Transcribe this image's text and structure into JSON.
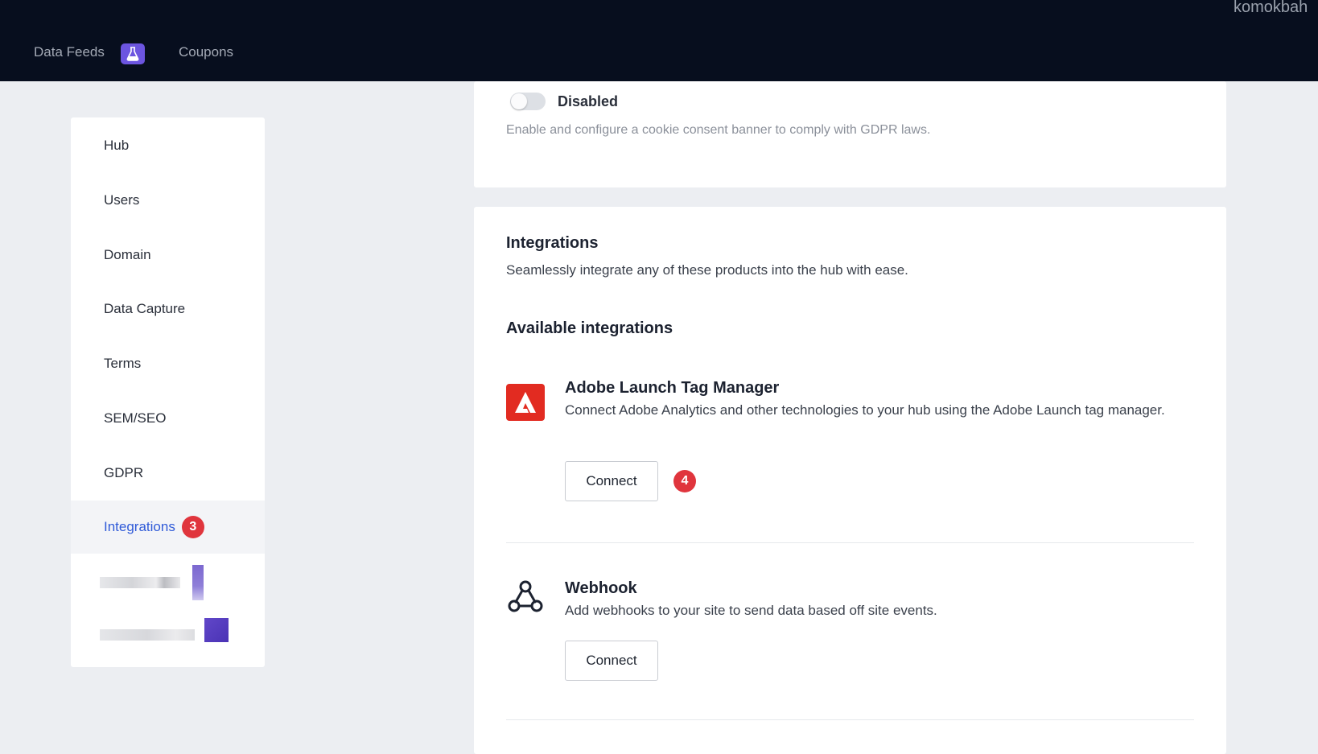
{
  "topbar": {
    "user": "komokbah",
    "nav": [
      {
        "label": "Data Feeds",
        "icon": "flask-icon"
      },
      {
        "label": "Coupons"
      }
    ]
  },
  "sidebar": {
    "items": [
      {
        "label": "Hub"
      },
      {
        "label": "Users"
      },
      {
        "label": "Domain"
      },
      {
        "label": "Data Capture"
      },
      {
        "label": "Terms"
      },
      {
        "label": "SEM/SEO"
      },
      {
        "label": "GDPR"
      },
      {
        "label": "Integrations",
        "badge": "3",
        "active": true
      }
    ]
  },
  "gdpr": {
    "toggle_label": "Disabled",
    "toggle_on": false,
    "description": "Enable and configure a cookie consent banner to comply with GDPR laws."
  },
  "integrations": {
    "title": "Integrations",
    "subtitle": "Seamlessly integrate any of these products into the hub with ease.",
    "available_heading": "Available integrations",
    "items": [
      {
        "name": "Adobe Launch Tag Manager",
        "description": "Connect Adobe Analytics and other technologies to your hub using the Adobe Launch tag manager.",
        "button": "Connect",
        "badge": "4",
        "icon": "adobe-icon"
      },
      {
        "name": "Webhook",
        "description": "Add webhooks to your site to send data based off site events.",
        "button": "Connect",
        "icon": "webhook-icon"
      }
    ]
  },
  "colors": {
    "topbar_bg": "#070e1e",
    "accent": "#2f5ad8",
    "badge": "#e0353d",
    "adobe_red": "#e22b21",
    "beta_purple": "#6c55e0"
  }
}
